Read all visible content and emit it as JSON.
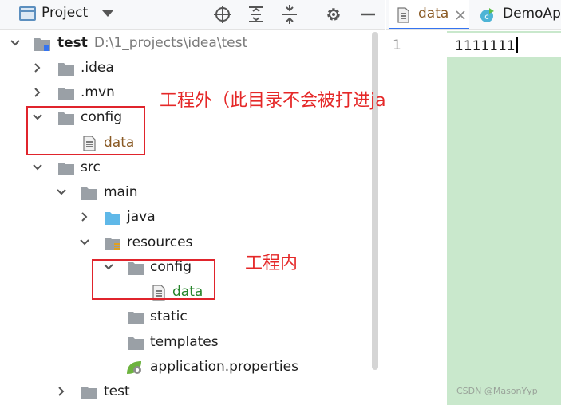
{
  "project_panel": {
    "view_title": "Project",
    "toolbar_icons": [
      "locate-target-icon",
      "expand-all-icon",
      "collapse-all-icon",
      "gear-icon",
      "minimize-icon"
    ],
    "tree": [
      {
        "label": "test",
        "path": "D:\\1_projects\\idea\\test",
        "expanded": true,
        "icon": "module-folder-icon"
      },
      {
        "label": ".idea",
        "expanded": false,
        "icon": "folder-icon"
      },
      {
        "label": ".mvn",
        "expanded": false,
        "icon": "folder-icon"
      },
      {
        "label": "config",
        "expanded": true,
        "icon": "folder-icon"
      },
      {
        "label": "data",
        "icon": "text-file-icon",
        "status": "modified"
      },
      {
        "label": "src",
        "expanded": true,
        "icon": "folder-icon"
      },
      {
        "label": "main",
        "expanded": true,
        "icon": "folder-icon"
      },
      {
        "label": "java",
        "expanded": false,
        "icon": "source-folder-icon"
      },
      {
        "label": "resources",
        "expanded": true,
        "icon": "resources-folder-icon"
      },
      {
        "label": "config",
        "expanded": true,
        "icon": "folder-icon"
      },
      {
        "label": "data",
        "icon": "text-file-icon",
        "status": "added"
      },
      {
        "label": "static",
        "icon": "folder-icon"
      },
      {
        "label": "templates",
        "icon": "folder-icon"
      },
      {
        "label": "application.properties",
        "icon": "spring-properties-icon"
      },
      {
        "label": "test",
        "expanded": false,
        "icon": "folder-icon"
      }
    ]
  },
  "annotations": {
    "outside_project": "工程外（此目录不会被打进jar包）",
    "inside_project": "工程内"
  },
  "editor": {
    "tabs": [
      {
        "label": "data",
        "active": true,
        "icon": "text-file-icon"
      },
      {
        "label": "DemoAp",
        "active": false,
        "icon": "class-icon"
      }
    ],
    "line_number": "1",
    "code_line": "1111111"
  },
  "watermark": "CSDN @MasonYyp",
  "colors": {
    "annotation_red": "#e52828",
    "modified_file": "#8a5a24",
    "added_file": "#25842a",
    "accent_blue": "#3574f0",
    "editor_background": "#c9e8cc"
  }
}
